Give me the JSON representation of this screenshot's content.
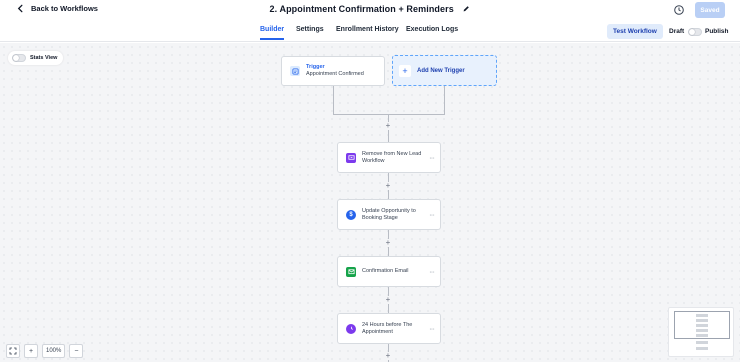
{
  "header": {
    "back_label": "Back to Workflows",
    "title": "2. Appointment Confirmation + Reminders",
    "saved_label": "Saved"
  },
  "tabs": [
    {
      "label": "Builder",
      "active": true
    },
    {
      "label": "Settings",
      "active": false
    },
    {
      "label": "Enrollment History",
      "active": false
    },
    {
      "label": "Execution Logs",
      "active": false
    }
  ],
  "actions": {
    "test_label": "Test Workflow",
    "draft_label": "Draft",
    "publish_label": "Publish"
  },
  "canvas": {
    "stats_view_label": "Stats View",
    "trigger": {
      "title": "Trigger",
      "name": "Appointment Confirmed"
    },
    "add_trigger_label": "Add New Trigger",
    "plus_symbol": "+",
    "steps": [
      {
        "line1": "Remove from New Lead",
        "line2": "Workflow",
        "icon": "workflow-icon",
        "color": "#7c3aed"
      },
      {
        "line1": "Update Opportunity to",
        "line2": "Booking Stage",
        "icon": "dollar-icon",
        "color": "#2563eb"
      },
      {
        "line1": "Confirmation Email",
        "line2": "",
        "icon": "email-icon",
        "color": "#16a34a"
      },
      {
        "line1": "24 Hours before The",
        "line2": "Appointment",
        "icon": "clock-icon",
        "color": "#7c3aed"
      }
    ],
    "more_symbol": "···",
    "zoom": {
      "level": "100%",
      "plus": "+",
      "minus": "−"
    }
  }
}
